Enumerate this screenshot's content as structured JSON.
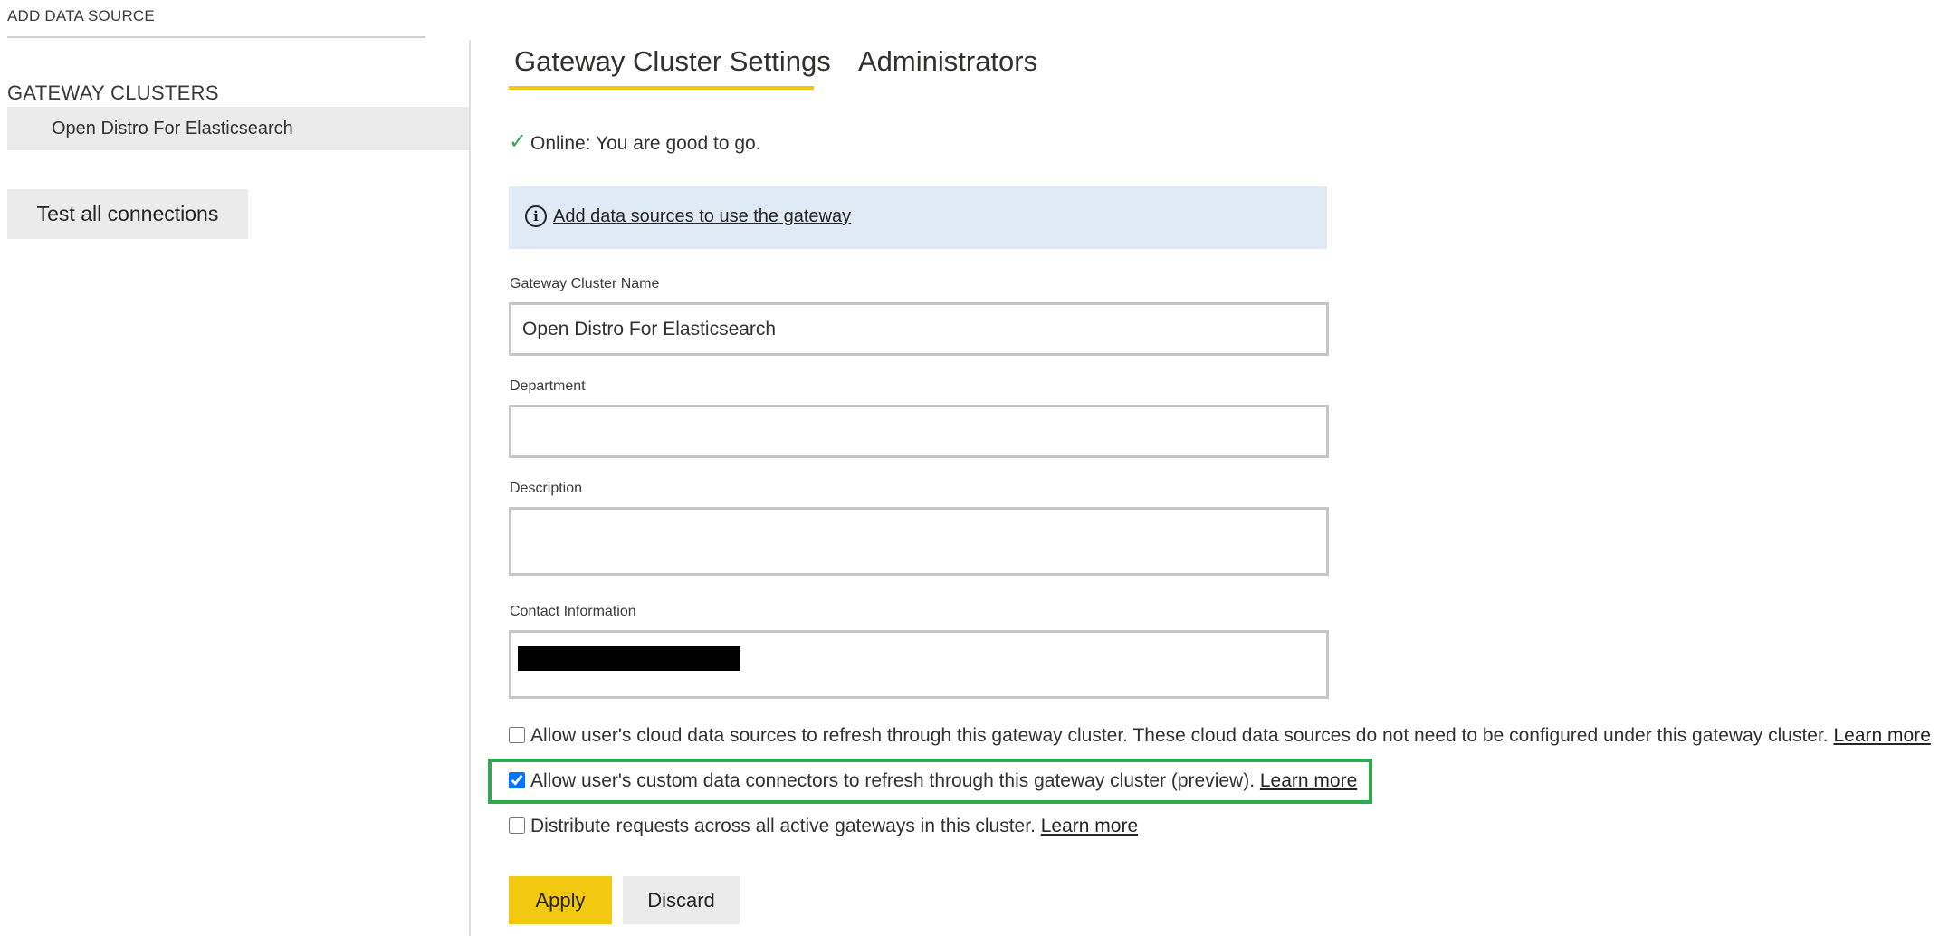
{
  "sidebar": {
    "add_data_source": "ADD DATA SOURCE",
    "gateway_clusters_heading": "GATEWAY CLUSTERS",
    "cluster_name": "Open Distro For Elasticsearch",
    "test_all_connections": "Test all connections"
  },
  "tabs": {
    "settings": "Gateway Cluster Settings",
    "administrators": "Administrators"
  },
  "status": {
    "icon": "check-icon",
    "glyph": "✓",
    "text": "Online: You are good to go."
  },
  "info_banner": {
    "icon": "info-icon",
    "glyph": "i",
    "link_text": "Add data sources to use the gateway"
  },
  "form": {
    "name_label": "Gateway Cluster Name",
    "name_value": "Open Distro For Elasticsearch",
    "department_label": "Department",
    "department_value": "",
    "description_label": "Description",
    "description_value": "",
    "contact_label": "Contact Information"
  },
  "options": {
    "cloud_text": "Allow user's cloud data sources to refresh through this gateway cluster. These cloud data sources do not need to be configured under this gateway cluster.",
    "cloud_link": "Learn more",
    "cloud_checked": false,
    "custom_text": "Allow user's custom data connectors to refresh through this gateway cluster (preview).",
    "custom_link": "Learn more",
    "custom_checked": true,
    "distribute_text": "Distribute requests across all active gateways in this cluster.",
    "distribute_link": "Learn more",
    "distribute_checked": false
  },
  "actions": {
    "apply": "Apply",
    "discard": "Discard"
  },
  "colors": {
    "accent_yellow": "#f2c811",
    "online_green": "#2fa84f",
    "highlight_green": "#2fa84f",
    "banner_blue": "#deeaf6",
    "button_gray": "#ebebeb"
  }
}
